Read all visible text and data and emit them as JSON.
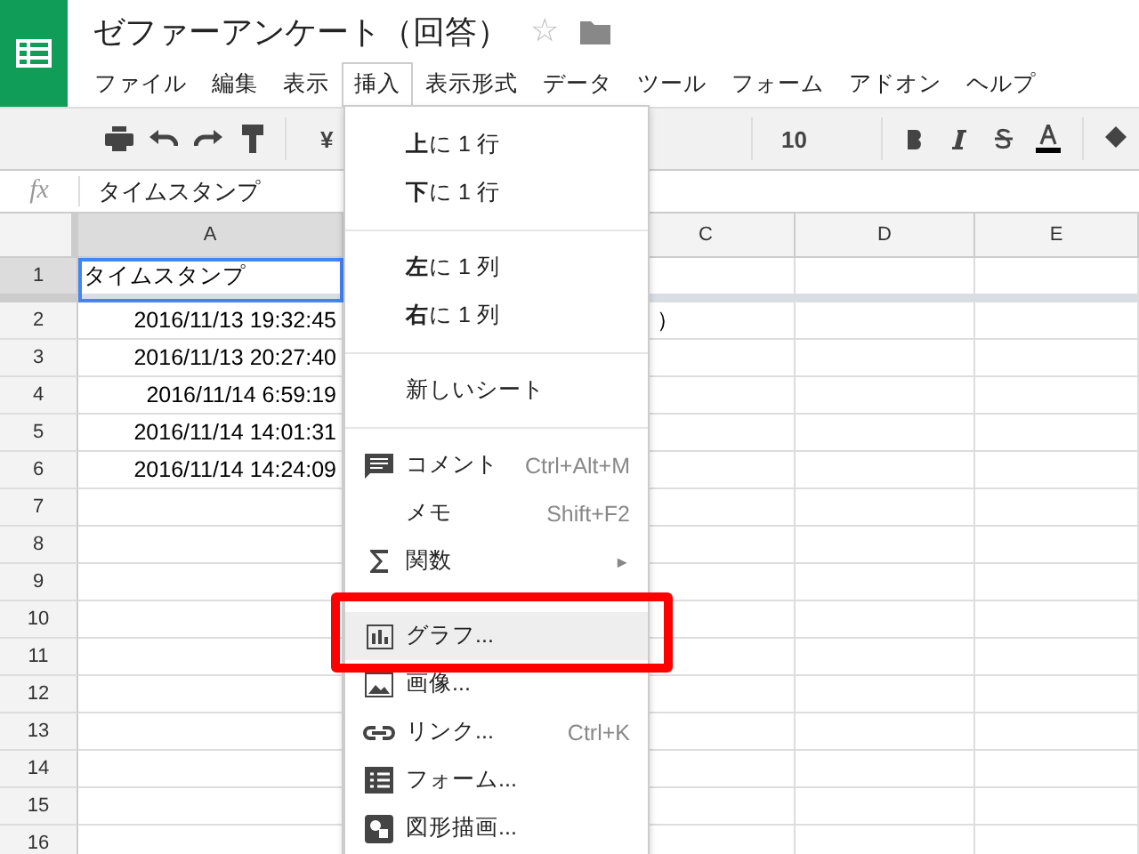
{
  "document": {
    "title": "ゼファーアンケート（回答）",
    "star": "☆"
  },
  "menubar": [
    {
      "label": "ファイル",
      "selected": false
    },
    {
      "label": "編集",
      "selected": false
    },
    {
      "label": "表示",
      "selected": false
    },
    {
      "label": "挿入",
      "selected": true
    },
    {
      "label": "表示形式",
      "selected": false
    },
    {
      "label": "データ",
      "selected": false
    },
    {
      "label": "ツール",
      "selected": false
    },
    {
      "label": "フォーム",
      "selected": false
    },
    {
      "label": "アドオン",
      "selected": false
    },
    {
      "label": "ヘルプ",
      "selected": false
    }
  ],
  "toolbar": {
    "currency": "¥",
    "font_size": "10"
  },
  "formula_bar": {
    "fx": "fx",
    "value": "タイムスタンプ"
  },
  "columns": [
    {
      "label": "A",
      "selected": true
    },
    {
      "label": "C",
      "selected": false
    },
    {
      "label": "D",
      "selected": false
    },
    {
      "label": "E",
      "selected": false
    }
  ],
  "rows": [
    {
      "number": "1",
      "selected": true,
      "cells": [
        {
          "text": "タイムスタンプ",
          "kind": "text",
          "selected": true
        }
      ]
    },
    {
      "number": "2",
      "selected": false,
      "cells": [
        {
          "text": "2016/11/13 19:32:45",
          "kind": "date",
          "selected": false
        }
      ],
      "overflow": "）"
    },
    {
      "number": "3",
      "selected": false,
      "cells": [
        {
          "text": "2016/11/13 20:27:40",
          "kind": "date",
          "selected": false
        }
      ]
    },
    {
      "number": "4",
      "selected": false,
      "cells": [
        {
          "text": "2016/11/14 6:59:19",
          "kind": "date",
          "selected": false
        }
      ]
    },
    {
      "number": "5",
      "selected": false,
      "cells": [
        {
          "text": "2016/11/14 14:01:31",
          "kind": "date",
          "selected": false
        }
      ]
    },
    {
      "number": "6",
      "selected": false,
      "cells": [
        {
          "text": "2016/11/14 14:24:09",
          "kind": "date",
          "selected": false
        }
      ]
    },
    {
      "number": "7",
      "selected": false,
      "cells": []
    },
    {
      "number": "8",
      "selected": false,
      "cells": []
    },
    {
      "number": "9",
      "selected": false,
      "cells": []
    },
    {
      "number": "10",
      "selected": false,
      "cells": []
    },
    {
      "number": "11",
      "selected": false,
      "cells": []
    },
    {
      "number": "12",
      "selected": false,
      "cells": []
    },
    {
      "number": "13",
      "selected": false,
      "cells": []
    },
    {
      "number": "14",
      "selected": false,
      "cells": []
    },
    {
      "number": "15",
      "selected": false,
      "cells": []
    },
    {
      "number": "16",
      "selected": false,
      "cells": []
    }
  ],
  "insert_menu": [
    {
      "kind": "plain",
      "label": "**上**に 1 行",
      "highlighted": false
    },
    {
      "kind": "plain",
      "label": "**下**に 1 行",
      "highlighted": false
    },
    {
      "kind": "divider"
    },
    {
      "kind": "plain",
      "label": "**左**に 1 列",
      "highlighted": false
    },
    {
      "kind": "plain",
      "label": "**右**に 1 列",
      "highlighted": false
    },
    {
      "kind": "divider"
    },
    {
      "kind": "plain",
      "label": "新しいシート",
      "highlighted": false
    },
    {
      "kind": "divider"
    },
    {
      "kind": "comment",
      "label": "コメント",
      "shortcut": "Ctrl+Alt+M",
      "highlighted": false
    },
    {
      "kind": "plain",
      "label": "メモ",
      "shortcut": "Shift+F2",
      "highlighted": false
    },
    {
      "kind": "function",
      "label": "関数",
      "submenu": "►",
      "highlighted": false
    },
    {
      "kind": "divider"
    },
    {
      "kind": "chart",
      "label": "グラフ...",
      "highlighted": true
    },
    {
      "kind": "image",
      "label": "画像...",
      "highlighted": false
    },
    {
      "kind": "link",
      "label": "リンク...",
      "shortcut": "Ctrl+K",
      "highlighted": false
    },
    {
      "kind": "form",
      "label": "フォーム...",
      "highlighted": false
    },
    {
      "kind": "drawing",
      "label": "図形描画...",
      "highlighted": false
    }
  ]
}
